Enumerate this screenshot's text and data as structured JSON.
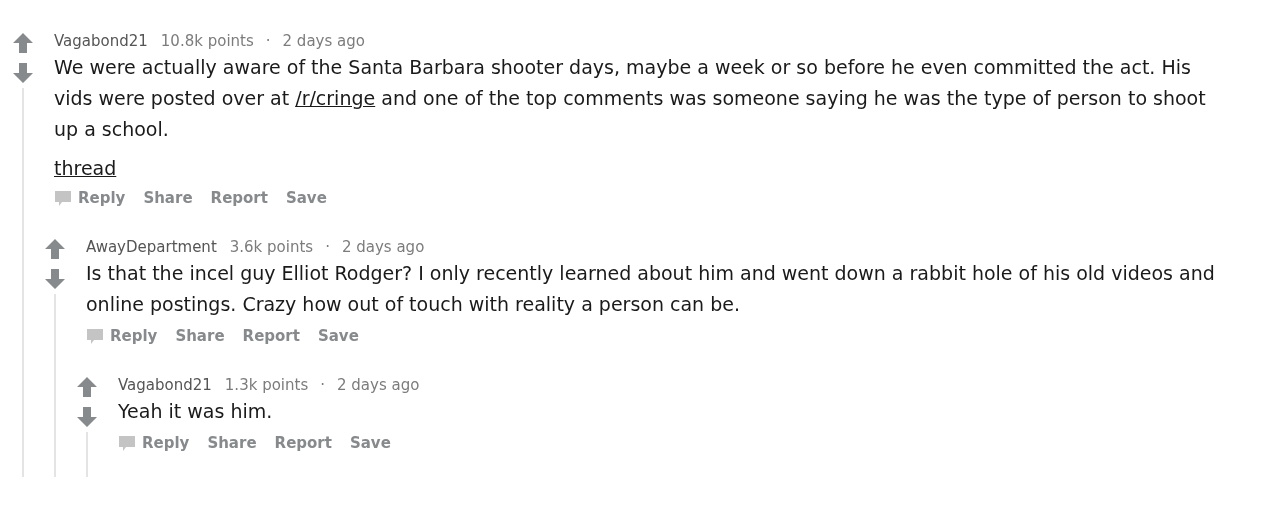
{
  "comments": [
    {
      "author": "Vagabond21",
      "points": "10.8k points",
      "separator": "·",
      "time": "2 days ago",
      "body": [
        {
          "kind": "text",
          "text": "We were actually aware of the Santa Barbara shooter days, maybe a week or so before he even committed the act. His vids were posted over at "
        },
        {
          "kind": "link",
          "text": "/r/cringe"
        },
        {
          "kind": "text",
          "text": " and one of the top comments was someone saying he was the type of person to shoot up a school."
        }
      ],
      "links": [
        "thread"
      ],
      "actions": [
        "Reply",
        "Share",
        "Report",
        "Save"
      ],
      "children": [
        {
          "author": "AwayDepartment",
          "points": "3.6k points",
          "separator": "·",
          "time": "2 days ago",
          "body": [
            {
              "kind": "text",
              "text": "Is that the incel guy Elliot Rodger? I only recently learned about him and went down a rabbit hole of his old videos and online postings. Crazy how out of touch with reality a person can be."
            }
          ],
          "actions": [
            "Reply",
            "Share",
            "Report",
            "Save"
          ],
          "children": [
            {
              "author": "Vagabond21",
              "points": "1.3k points",
              "separator": "·",
              "time": "2 days ago",
              "body": [
                {
                  "kind": "text",
                  "text": "Yeah it was him."
                }
              ],
              "actions": [
                "Reply",
                "Share",
                "Report",
                "Save"
              ]
            }
          ]
        }
      ]
    }
  ]
}
